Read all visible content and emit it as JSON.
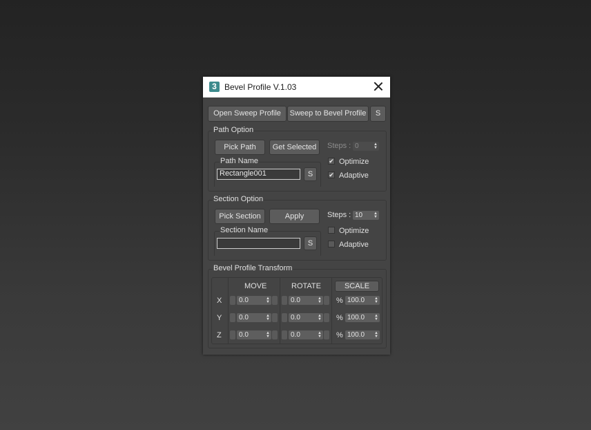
{
  "window": {
    "title": "Bevel Profile V.1.03",
    "icon_glyph": "3"
  },
  "toolbar": {
    "open_sweep": "Open Sweep Profile",
    "sweep_to_bevel": "Sweep to Bevel Profile",
    "s": "S"
  },
  "path_option": {
    "title": "Path Option",
    "pick_path": "Pick Path",
    "get_selected": "Get Selected",
    "steps_label": "Steps :",
    "steps_value": "0",
    "name_label": "Path Name",
    "name_value": "Rectangle001",
    "s": "S",
    "optimize": {
      "label": "Optimize",
      "checked": "✔"
    },
    "adaptive": {
      "label": "Adaptive",
      "checked": "✔"
    }
  },
  "section_option": {
    "title": "Section Option",
    "pick_section": "Pick Section",
    "apply": "Apply",
    "steps_label": "Steps :",
    "steps_value": "10",
    "name_label": "Section Name",
    "name_value": "",
    "s": "S",
    "optimize": {
      "label": "Optimize",
      "checked": ""
    },
    "adaptive": {
      "label": "Adaptive",
      "checked": ""
    }
  },
  "transform": {
    "title": "Bevel Profile Transform",
    "move": "MOVE",
    "rotate": "ROTATE",
    "scale": "SCALE",
    "pct": "%",
    "rows": [
      {
        "axis": "X",
        "move": "0.0",
        "rotate": "0.0",
        "scale": "100.0"
      },
      {
        "axis": "Y",
        "move": "0.0",
        "rotate": "0.0",
        "scale": "100.0"
      },
      {
        "axis": "Z",
        "move": "0.0",
        "rotate": "0.0",
        "scale": "100.0"
      }
    ]
  }
}
